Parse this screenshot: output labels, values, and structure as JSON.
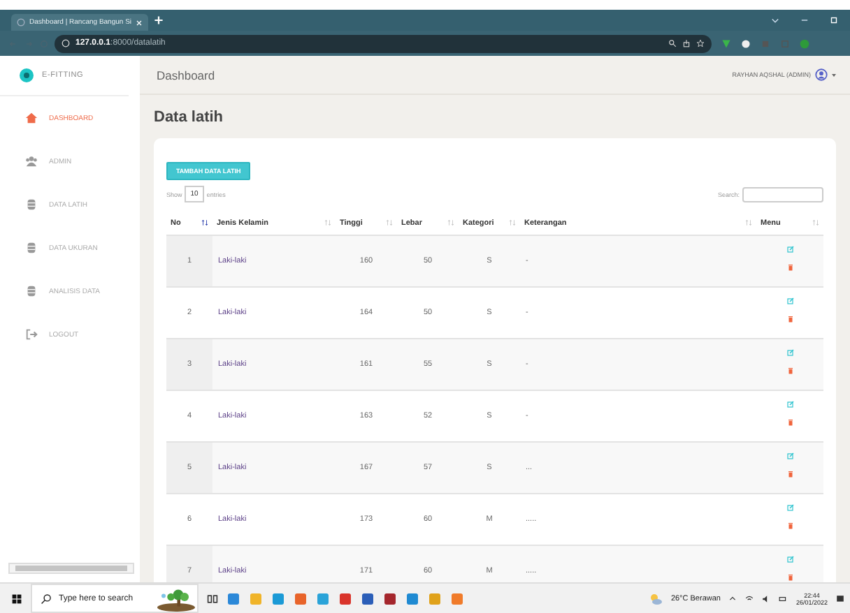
{
  "browser": {
    "tab_title": "Dashboard | Rancang Bangun Si",
    "url_host": "127.0.0.1",
    "url_path": ":8000/datalatih"
  },
  "app": {
    "brand": "E-FITTING",
    "header_title": "Dashboard",
    "user": "RAYHAN AQSHAL (ADMIN)"
  },
  "sidebar": {
    "items": [
      {
        "label": "DASHBOARD",
        "kind": "home",
        "selected": true
      },
      {
        "label": "ADMIN",
        "kind": "users",
        "selected": false
      },
      {
        "label": "DATA LATIH",
        "kind": "db",
        "selected": false
      },
      {
        "label": "DATA UKURAN",
        "kind": "db",
        "selected": false
      },
      {
        "label": "ANALISIS DATA",
        "kind": "db",
        "selected": false
      },
      {
        "label": "LOGOUT",
        "kind": "logout",
        "selected": false
      }
    ]
  },
  "page": {
    "title": "Data latih",
    "add_button": "TAMBAH DATA LATIH",
    "show_label": "Show",
    "entries_value": "10",
    "entries_label": "entries",
    "search_label": "Search:"
  },
  "table": {
    "columns": [
      {
        "label": "No",
        "sorted": true
      },
      {
        "label": "Jenis Kelamin",
        "sorted": false
      },
      {
        "label": "Tinggi",
        "sorted": false
      },
      {
        "label": "Lebar",
        "sorted": false
      },
      {
        "label": "Kategori",
        "sorted": false
      },
      {
        "label": "Keterangan",
        "sorted": false
      },
      {
        "label": "Menu",
        "sorted": false
      }
    ],
    "rows": [
      [
        "1",
        "Laki-laki",
        "160",
        "50",
        "S",
        "-"
      ],
      [
        "2",
        "Laki-laki",
        "164",
        "50",
        "S",
        "-"
      ],
      [
        "3",
        "Laki-laki",
        "161",
        "55",
        "S",
        "-"
      ],
      [
        "4",
        "Laki-laki",
        "163",
        "52",
        "S",
        "-"
      ],
      [
        "5",
        "Laki-laki",
        "167",
        "57",
        "S",
        "..."
      ],
      [
        "6",
        "Laki-laki",
        "173",
        "60",
        "M",
        "....."
      ],
      [
        "7",
        "Laki-laki",
        "171",
        "60",
        "M",
        "....."
      ]
    ]
  },
  "taskbar": {
    "search_placeholder": "Type here to search",
    "weather": "26°C Berawan",
    "time": "22:44",
    "date": "26/01/2022"
  }
}
